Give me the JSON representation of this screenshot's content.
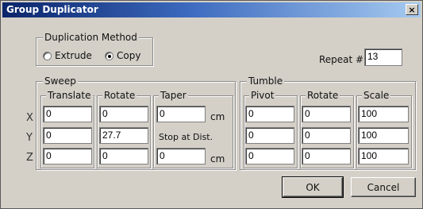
{
  "window": {
    "title": "Group Duplicator",
    "close_glyph": "×"
  },
  "duplication_method": {
    "legend": "Duplication Method",
    "options": [
      {
        "label": "Extrude",
        "checked": false
      },
      {
        "label": "Copy",
        "checked": true
      }
    ]
  },
  "repeat": {
    "label": "Repeat #",
    "value": "13"
  },
  "sweep": {
    "legend": "Sweep",
    "translate": {
      "legend": "Translate",
      "values": [
        "0",
        "0",
        "0"
      ]
    },
    "rotate": {
      "legend": "Rotate",
      "values": [
        "0",
        "27.7",
        "0"
      ]
    },
    "taper": {
      "legend": "Taper",
      "value_top": "0",
      "unit_top": "cm",
      "stop_label": "Stop at Dist.",
      "value_bottom": "0",
      "unit_bottom": "cm"
    }
  },
  "axes": [
    "X",
    "Y",
    "Z"
  ],
  "tumble": {
    "legend": "Tumble",
    "pivot": {
      "legend": "Pivot",
      "values": [
        "0",
        "0",
        "0"
      ]
    },
    "rotate": {
      "legend": "Rotate",
      "values": [
        "0",
        "0",
        "0"
      ]
    },
    "scale": {
      "legend": "Scale",
      "values": [
        "100",
        "100",
        "100"
      ]
    }
  },
  "buttons": {
    "ok": "OK",
    "cancel": "Cancel"
  }
}
